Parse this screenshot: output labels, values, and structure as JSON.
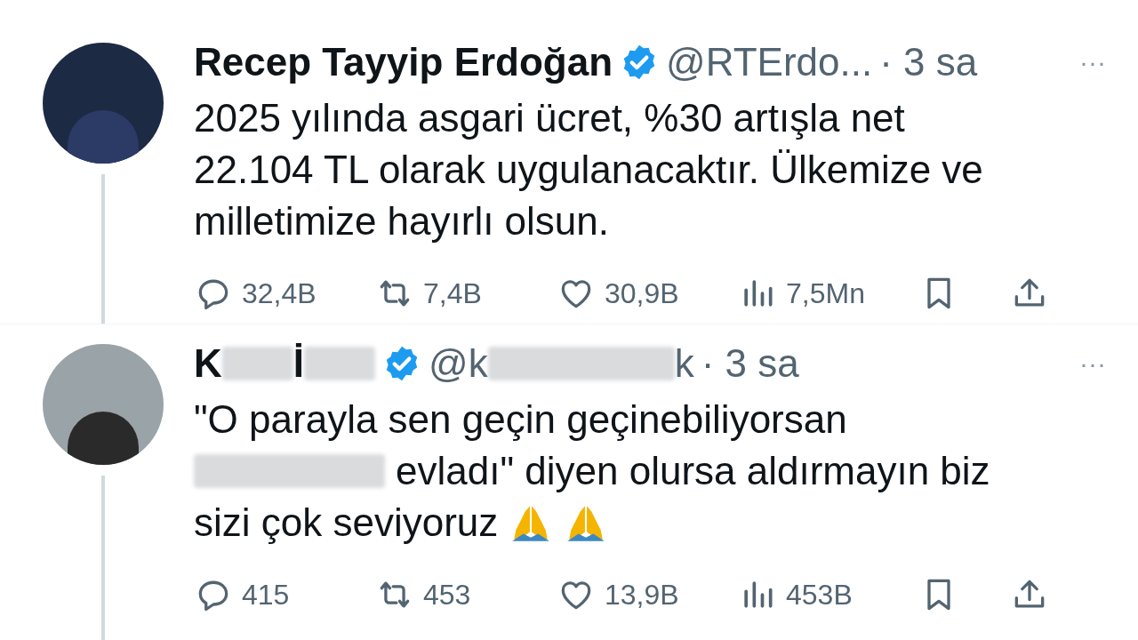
{
  "tweets": [
    {
      "name": [
        {
          "kind": "text",
          "text": "Recep Tayyip Erdoğan"
        }
      ],
      "handle": [
        {
          "kind": "text",
          "text": "@RTErdo..."
        }
      ],
      "verified": true,
      "time": "· 3 sa",
      "more": "···",
      "lines": [
        [
          {
            "kind": "text",
            "text": "2025 yılında asgari ücret, %30 artışla net"
          }
        ],
        [
          {
            "kind": "text",
            "text": "22.104 TL olarak uygulanacaktır. Ülkemize ve"
          }
        ],
        [
          {
            "kind": "text",
            "text": "milletimize hayırlı olsun."
          }
        ]
      ],
      "stats": {
        "replies": "32,4B",
        "reposts": "7,4B",
        "likes": "30,9B",
        "views": "7,5Mn"
      }
    },
    {
      "name": [
        {
          "kind": "text",
          "text": "K"
        },
        {
          "kind": "blur"
        },
        {
          "kind": "text",
          "text": "İ"
        },
        {
          "kind": "blur"
        }
      ],
      "handle": [
        {
          "kind": "text",
          "text": "@k"
        },
        {
          "kind": "blur"
        },
        {
          "kind": "text",
          "text": "k"
        }
      ],
      "verified": true,
      "time": "· 3 sa",
      "more": "···",
      "lines": [
        [
          {
            "kind": "text",
            "text": "\"O parayla sen geçin geçinebiliyorsan"
          }
        ],
        [
          {
            "kind": "blur"
          },
          {
            "kind": "text",
            "text": "evladı\" diyen olursa aldırmayın biz"
          }
        ],
        [
          {
            "kind": "text",
            "text": "sizi çok seviyoruz"
          },
          {
            "kind": "emoji"
          },
          {
            "kind": "emoji"
          }
        ]
      ],
      "stats": {
        "replies": "415",
        "reposts": "453",
        "likes": "13,9B",
        "views": "453B"
      }
    }
  ]
}
